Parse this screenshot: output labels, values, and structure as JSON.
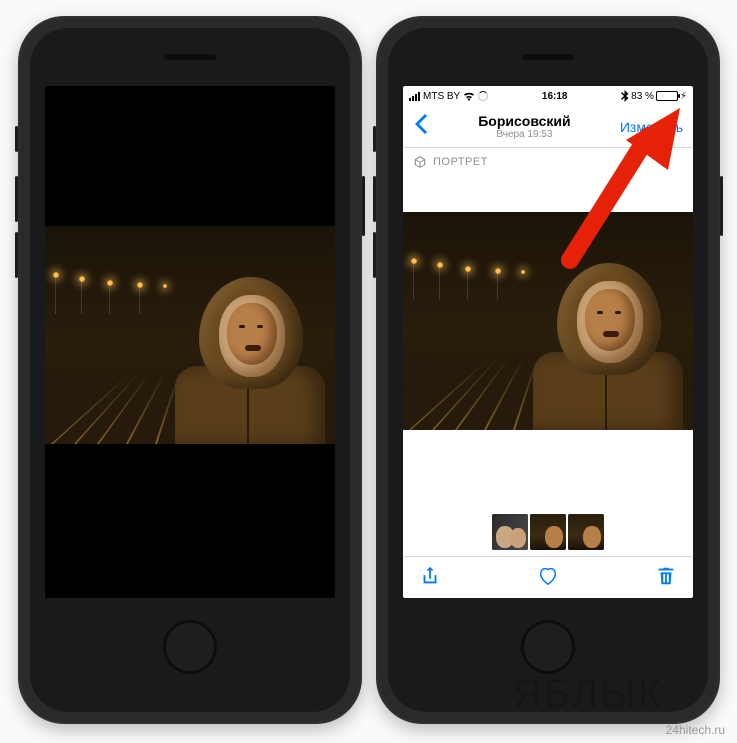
{
  "statusbar": {
    "carrier": "MTS BY",
    "time": "16:18",
    "battery_pct": "83 %",
    "battery_fill_pct": 83
  },
  "navbar": {
    "title": "Борисовский",
    "subtitle": "Вчера 19:53",
    "edit_label": "Изменить"
  },
  "mode": {
    "label": "ПОРТРЕТ",
    "icon_name": "cube-icon"
  },
  "toolbar": {
    "share_icon": "share-icon",
    "like_icon": "heart-icon",
    "delete_icon": "trash-icon"
  },
  "thumbnails": {
    "count": 3
  },
  "annotation": {
    "target": "edit-button"
  },
  "watermark": {
    "logo": "ЯБЛЫК",
    "site": "24hitech.ru"
  },
  "colors": {
    "ios_blue": "#007aff",
    "arrow_red": "#e52207"
  }
}
